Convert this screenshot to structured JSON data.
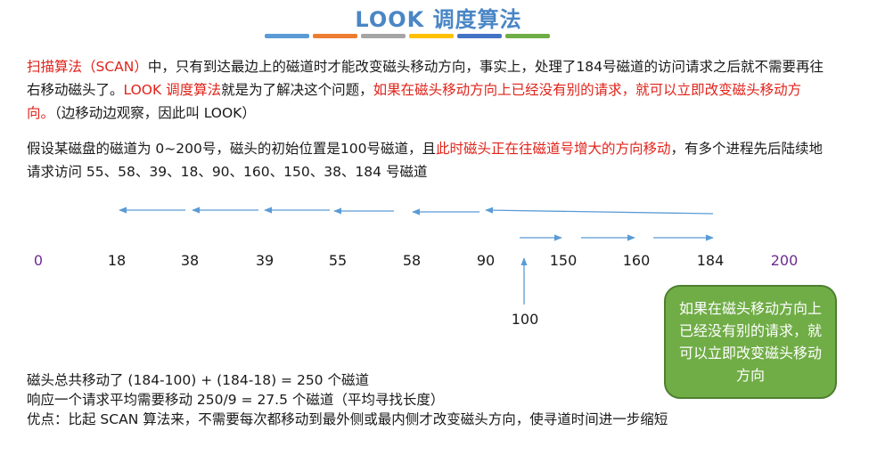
{
  "title": "LOOK 调度算法",
  "title_bar_colors": [
    "#5b9bd5",
    "#ed7d31",
    "#a5a5a5",
    "#ffc000",
    "#4472c4",
    "#70ad47"
  ],
  "intro": {
    "p1": "扫描算法（SCAN）",
    "p2": "中，只有到达最边上的磁道时才能改变磁头移动方向，事实上，处理了184号磁道的访问请求之后就不需要再往右移动磁头了。",
    "p3": "LOOK 调度算法",
    "p4": "就是为了解决这个问题，",
    "p5": "如果在磁头移动方向上已经没有别的请求，就可以立即改变磁头移动方向。",
    "p6": "（边移动边观察，因此叫 LOOK）"
  },
  "assume": {
    "a1": "假设某磁盘的磁道为 0~200号，磁头的初始位置是100号磁道，且",
    "a2": "此时磁头正在往磁道号增大的方向移动",
    "a3": "，有多个进程先后陆续地请求访问 55、58、39、18、90、160、150、38、184 号磁道"
  },
  "track_labels": [
    "0",
    "18",
    "38",
    "39",
    "55",
    "58",
    "90",
    "150",
    "160",
    "184",
    "200"
  ],
  "start_label": "100",
  "callout": "如果在磁头移动方向上已经没有别的请求，就可以立即改变磁头移动方向",
  "stats": {
    "line1": "磁头总共移动了  (184-100) + (184-18) = 250 个磁道",
    "line2": "响应一个请求平均需要移动 250/9 = 27.5 个磁道（平均寻找长度）",
    "line3": "优点：比起 SCAN 算法来，不需要每次都移动到最外侧或最内侧才改变磁头方向，使寻道时间进一步缩短"
  },
  "colors": {
    "title": "#4a86c5",
    "highlight": "#e0231b",
    "edge_label": "#6d2c91",
    "arrow": "#5b9bd5",
    "callout_fill": "#70ad47"
  }
}
